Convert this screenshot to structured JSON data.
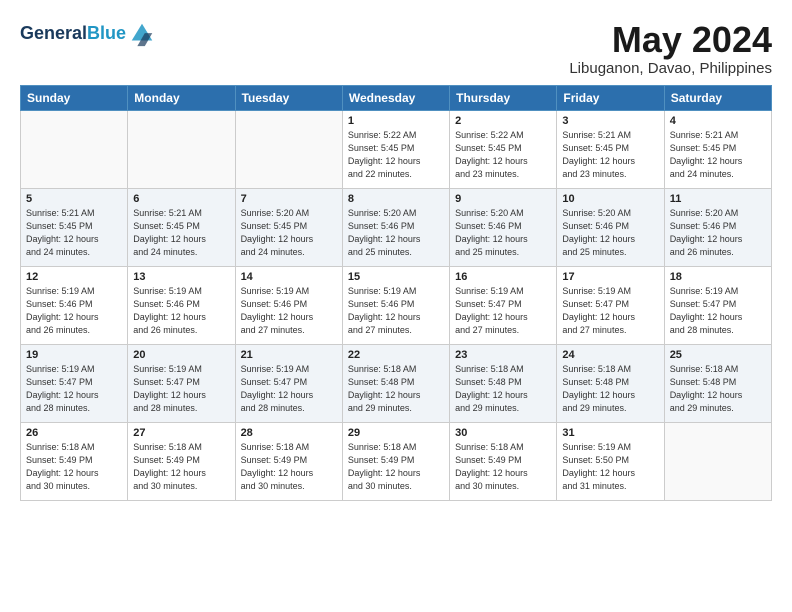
{
  "header": {
    "logo_line1": "General",
    "logo_line2": "Blue",
    "month_title": "May 2024",
    "location": "Libuganon, Davao, Philippines"
  },
  "days_of_week": [
    "Sunday",
    "Monday",
    "Tuesday",
    "Wednesday",
    "Thursday",
    "Friday",
    "Saturday"
  ],
  "weeks": [
    [
      {
        "day": "",
        "info": ""
      },
      {
        "day": "",
        "info": ""
      },
      {
        "day": "",
        "info": ""
      },
      {
        "day": "1",
        "info": "Sunrise: 5:22 AM\nSunset: 5:45 PM\nDaylight: 12 hours\nand 22 minutes."
      },
      {
        "day": "2",
        "info": "Sunrise: 5:22 AM\nSunset: 5:45 PM\nDaylight: 12 hours\nand 23 minutes."
      },
      {
        "day": "3",
        "info": "Sunrise: 5:21 AM\nSunset: 5:45 PM\nDaylight: 12 hours\nand 23 minutes."
      },
      {
        "day": "4",
        "info": "Sunrise: 5:21 AM\nSunset: 5:45 PM\nDaylight: 12 hours\nand 24 minutes."
      }
    ],
    [
      {
        "day": "5",
        "info": "Sunrise: 5:21 AM\nSunset: 5:45 PM\nDaylight: 12 hours\nand 24 minutes."
      },
      {
        "day": "6",
        "info": "Sunrise: 5:21 AM\nSunset: 5:45 PM\nDaylight: 12 hours\nand 24 minutes."
      },
      {
        "day": "7",
        "info": "Sunrise: 5:20 AM\nSunset: 5:45 PM\nDaylight: 12 hours\nand 24 minutes."
      },
      {
        "day": "8",
        "info": "Sunrise: 5:20 AM\nSunset: 5:46 PM\nDaylight: 12 hours\nand 25 minutes."
      },
      {
        "day": "9",
        "info": "Sunrise: 5:20 AM\nSunset: 5:46 PM\nDaylight: 12 hours\nand 25 minutes."
      },
      {
        "day": "10",
        "info": "Sunrise: 5:20 AM\nSunset: 5:46 PM\nDaylight: 12 hours\nand 25 minutes."
      },
      {
        "day": "11",
        "info": "Sunrise: 5:20 AM\nSunset: 5:46 PM\nDaylight: 12 hours\nand 26 minutes."
      }
    ],
    [
      {
        "day": "12",
        "info": "Sunrise: 5:19 AM\nSunset: 5:46 PM\nDaylight: 12 hours\nand 26 minutes."
      },
      {
        "day": "13",
        "info": "Sunrise: 5:19 AM\nSunset: 5:46 PM\nDaylight: 12 hours\nand 26 minutes."
      },
      {
        "day": "14",
        "info": "Sunrise: 5:19 AM\nSunset: 5:46 PM\nDaylight: 12 hours\nand 27 minutes."
      },
      {
        "day": "15",
        "info": "Sunrise: 5:19 AM\nSunset: 5:46 PM\nDaylight: 12 hours\nand 27 minutes."
      },
      {
        "day": "16",
        "info": "Sunrise: 5:19 AM\nSunset: 5:47 PM\nDaylight: 12 hours\nand 27 minutes."
      },
      {
        "day": "17",
        "info": "Sunrise: 5:19 AM\nSunset: 5:47 PM\nDaylight: 12 hours\nand 27 minutes."
      },
      {
        "day": "18",
        "info": "Sunrise: 5:19 AM\nSunset: 5:47 PM\nDaylight: 12 hours\nand 28 minutes."
      }
    ],
    [
      {
        "day": "19",
        "info": "Sunrise: 5:19 AM\nSunset: 5:47 PM\nDaylight: 12 hours\nand 28 minutes."
      },
      {
        "day": "20",
        "info": "Sunrise: 5:19 AM\nSunset: 5:47 PM\nDaylight: 12 hours\nand 28 minutes."
      },
      {
        "day": "21",
        "info": "Sunrise: 5:19 AM\nSunset: 5:47 PM\nDaylight: 12 hours\nand 28 minutes."
      },
      {
        "day": "22",
        "info": "Sunrise: 5:18 AM\nSunset: 5:48 PM\nDaylight: 12 hours\nand 29 minutes."
      },
      {
        "day": "23",
        "info": "Sunrise: 5:18 AM\nSunset: 5:48 PM\nDaylight: 12 hours\nand 29 minutes."
      },
      {
        "day": "24",
        "info": "Sunrise: 5:18 AM\nSunset: 5:48 PM\nDaylight: 12 hours\nand 29 minutes."
      },
      {
        "day": "25",
        "info": "Sunrise: 5:18 AM\nSunset: 5:48 PM\nDaylight: 12 hours\nand 29 minutes."
      }
    ],
    [
      {
        "day": "26",
        "info": "Sunrise: 5:18 AM\nSunset: 5:49 PM\nDaylight: 12 hours\nand 30 minutes."
      },
      {
        "day": "27",
        "info": "Sunrise: 5:18 AM\nSunset: 5:49 PM\nDaylight: 12 hours\nand 30 minutes."
      },
      {
        "day": "28",
        "info": "Sunrise: 5:18 AM\nSunset: 5:49 PM\nDaylight: 12 hours\nand 30 minutes."
      },
      {
        "day": "29",
        "info": "Sunrise: 5:18 AM\nSunset: 5:49 PM\nDaylight: 12 hours\nand 30 minutes."
      },
      {
        "day": "30",
        "info": "Sunrise: 5:18 AM\nSunset: 5:49 PM\nDaylight: 12 hours\nand 30 minutes."
      },
      {
        "day": "31",
        "info": "Sunrise: 5:19 AM\nSunset: 5:50 PM\nDaylight: 12 hours\nand 31 minutes."
      },
      {
        "day": "",
        "info": ""
      }
    ]
  ]
}
